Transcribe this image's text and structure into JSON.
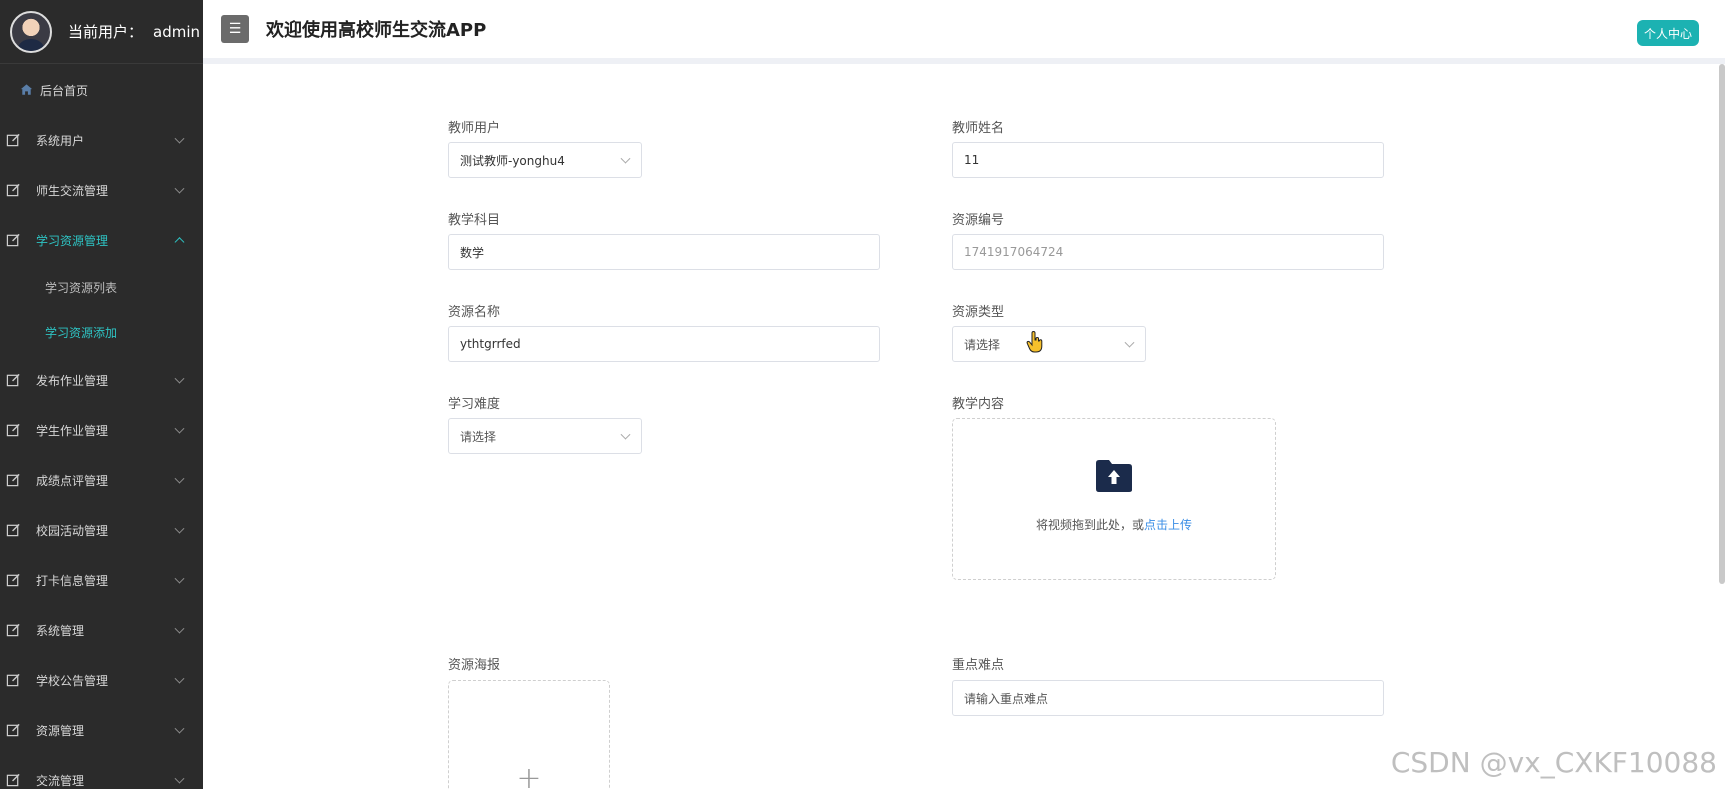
{
  "sidebar": {
    "user_label": "当前用户：",
    "user_name": "admin",
    "home": "后台首页",
    "items": [
      {
        "label": "系统用户"
      },
      {
        "label": "师生交流管理"
      },
      {
        "label": "学习资源管理"
      },
      {
        "label": "发布作业管理"
      },
      {
        "label": "学生作业管理"
      },
      {
        "label": "成绩点评管理"
      },
      {
        "label": "校园活动管理"
      },
      {
        "label": "打卡信息管理"
      },
      {
        "label": "系统管理"
      },
      {
        "label": "学校公告管理"
      },
      {
        "label": "资源管理"
      },
      {
        "label": "交流管理"
      }
    ],
    "submenu": [
      {
        "label": "学习资源列表"
      },
      {
        "label": "学习资源添加"
      }
    ],
    "active_color": "#2ec4c4"
  },
  "header": {
    "title": "欢迎使用高校师生交流APP",
    "profile_button": "个人中心"
  },
  "form": {
    "teacher_user": {
      "label": "教师用户",
      "value": "测试教师-yonghu4"
    },
    "teacher_name": {
      "label": "教师姓名",
      "value": "11"
    },
    "subject": {
      "label": "教学科目",
      "value": "数学"
    },
    "resource_no": {
      "label": "资源编号",
      "value": "1741917064724"
    },
    "resource_name": {
      "label": "资源名称",
      "value": "ythtgrrfed"
    },
    "resource_type": {
      "label": "资源类型",
      "placeholder": "请选择"
    },
    "difficulty": {
      "label": "学习难度",
      "placeholder": "请选择"
    },
    "content": {
      "label": "教学内容",
      "upload_text": "将视频拖到此处，或",
      "upload_link": "点击上传"
    },
    "poster": {
      "label": "资源海报"
    },
    "key_points": {
      "label": "重点难点",
      "placeholder": "请输入重点难点"
    }
  },
  "watermark": "CSDN @vx_CXKF10088"
}
